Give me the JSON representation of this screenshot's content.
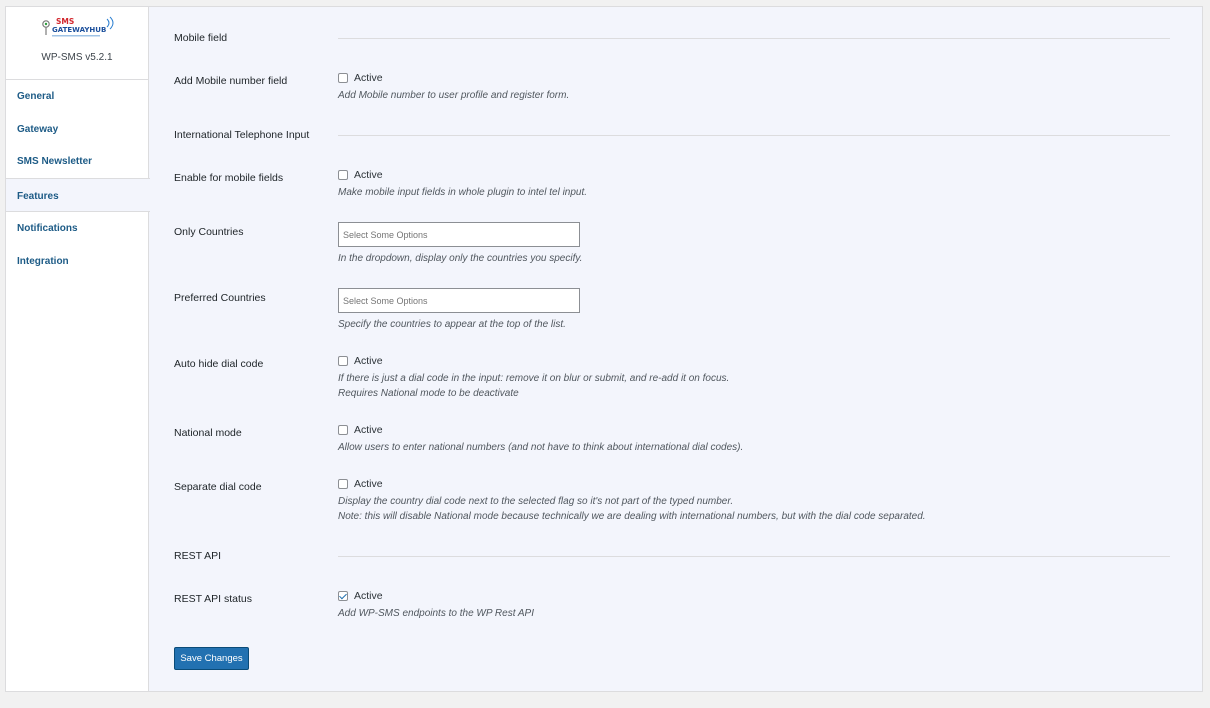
{
  "brand": {
    "logo_text": "SMS GATEWAYHUB",
    "version": "WP-SMS v5.2.1"
  },
  "nav": [
    {
      "label": "General"
    },
    {
      "label": "Gateway"
    },
    {
      "label": "SMS Newsletter"
    },
    {
      "label": "Features",
      "active": true
    },
    {
      "label": "Notifications"
    },
    {
      "label": "Integration"
    }
  ],
  "sections": {
    "mobile_field": "Mobile field",
    "intl_input": "International Telephone Input",
    "rest_api": "REST API"
  },
  "rows": {
    "add_mobile": {
      "label": "Add Mobile number field",
      "check": "Active",
      "checked": false,
      "desc": [
        "Add Mobile number to user profile and register form."
      ]
    },
    "enable_mobile": {
      "label": "Enable for mobile fields",
      "check": "Active",
      "checked": false,
      "desc": [
        "Make mobile input fields in whole plugin to intel tel input."
      ]
    },
    "only_countries": {
      "label": "Only Countries",
      "placeholder": "Select Some Options",
      "desc": [
        "In the dropdown, display only the countries you specify."
      ]
    },
    "preferred_countries": {
      "label": "Preferred Countries",
      "placeholder": "Select Some Options",
      "desc": [
        "Specify the countries to appear at the top of the list."
      ]
    },
    "auto_hide": {
      "label": "Auto hide dial code",
      "check": "Active",
      "checked": false,
      "desc": [
        "If there is just a dial code in the input: remove it on blur or submit, and re-add it on focus.",
        "Requires National mode to be deactivate"
      ]
    },
    "national_mode": {
      "label": "National mode",
      "check": "Active",
      "checked": false,
      "desc": [
        "Allow users to enter national numbers (and not have to think about international dial codes)."
      ]
    },
    "separate_dial": {
      "label": "Separate dial code",
      "check": "Active",
      "checked": false,
      "desc": [
        "Display the country dial code next to the selected flag so it's not part of the typed number.",
        "Note: this will disable National mode because technically we are dealing with international numbers, but with the dial code separated."
      ]
    },
    "rest_status": {
      "label": "REST API status",
      "check": "Active",
      "checked": true,
      "desc": [
        "Add WP-SMS endpoints to the WP Rest API"
      ]
    }
  },
  "save_button": "Save Changes",
  "colors": {
    "accent": "#2271b1",
    "nav_link": "#1d5b86",
    "panel_bg": "#f3f5fc",
    "page_bg": "#f1f1f1"
  }
}
